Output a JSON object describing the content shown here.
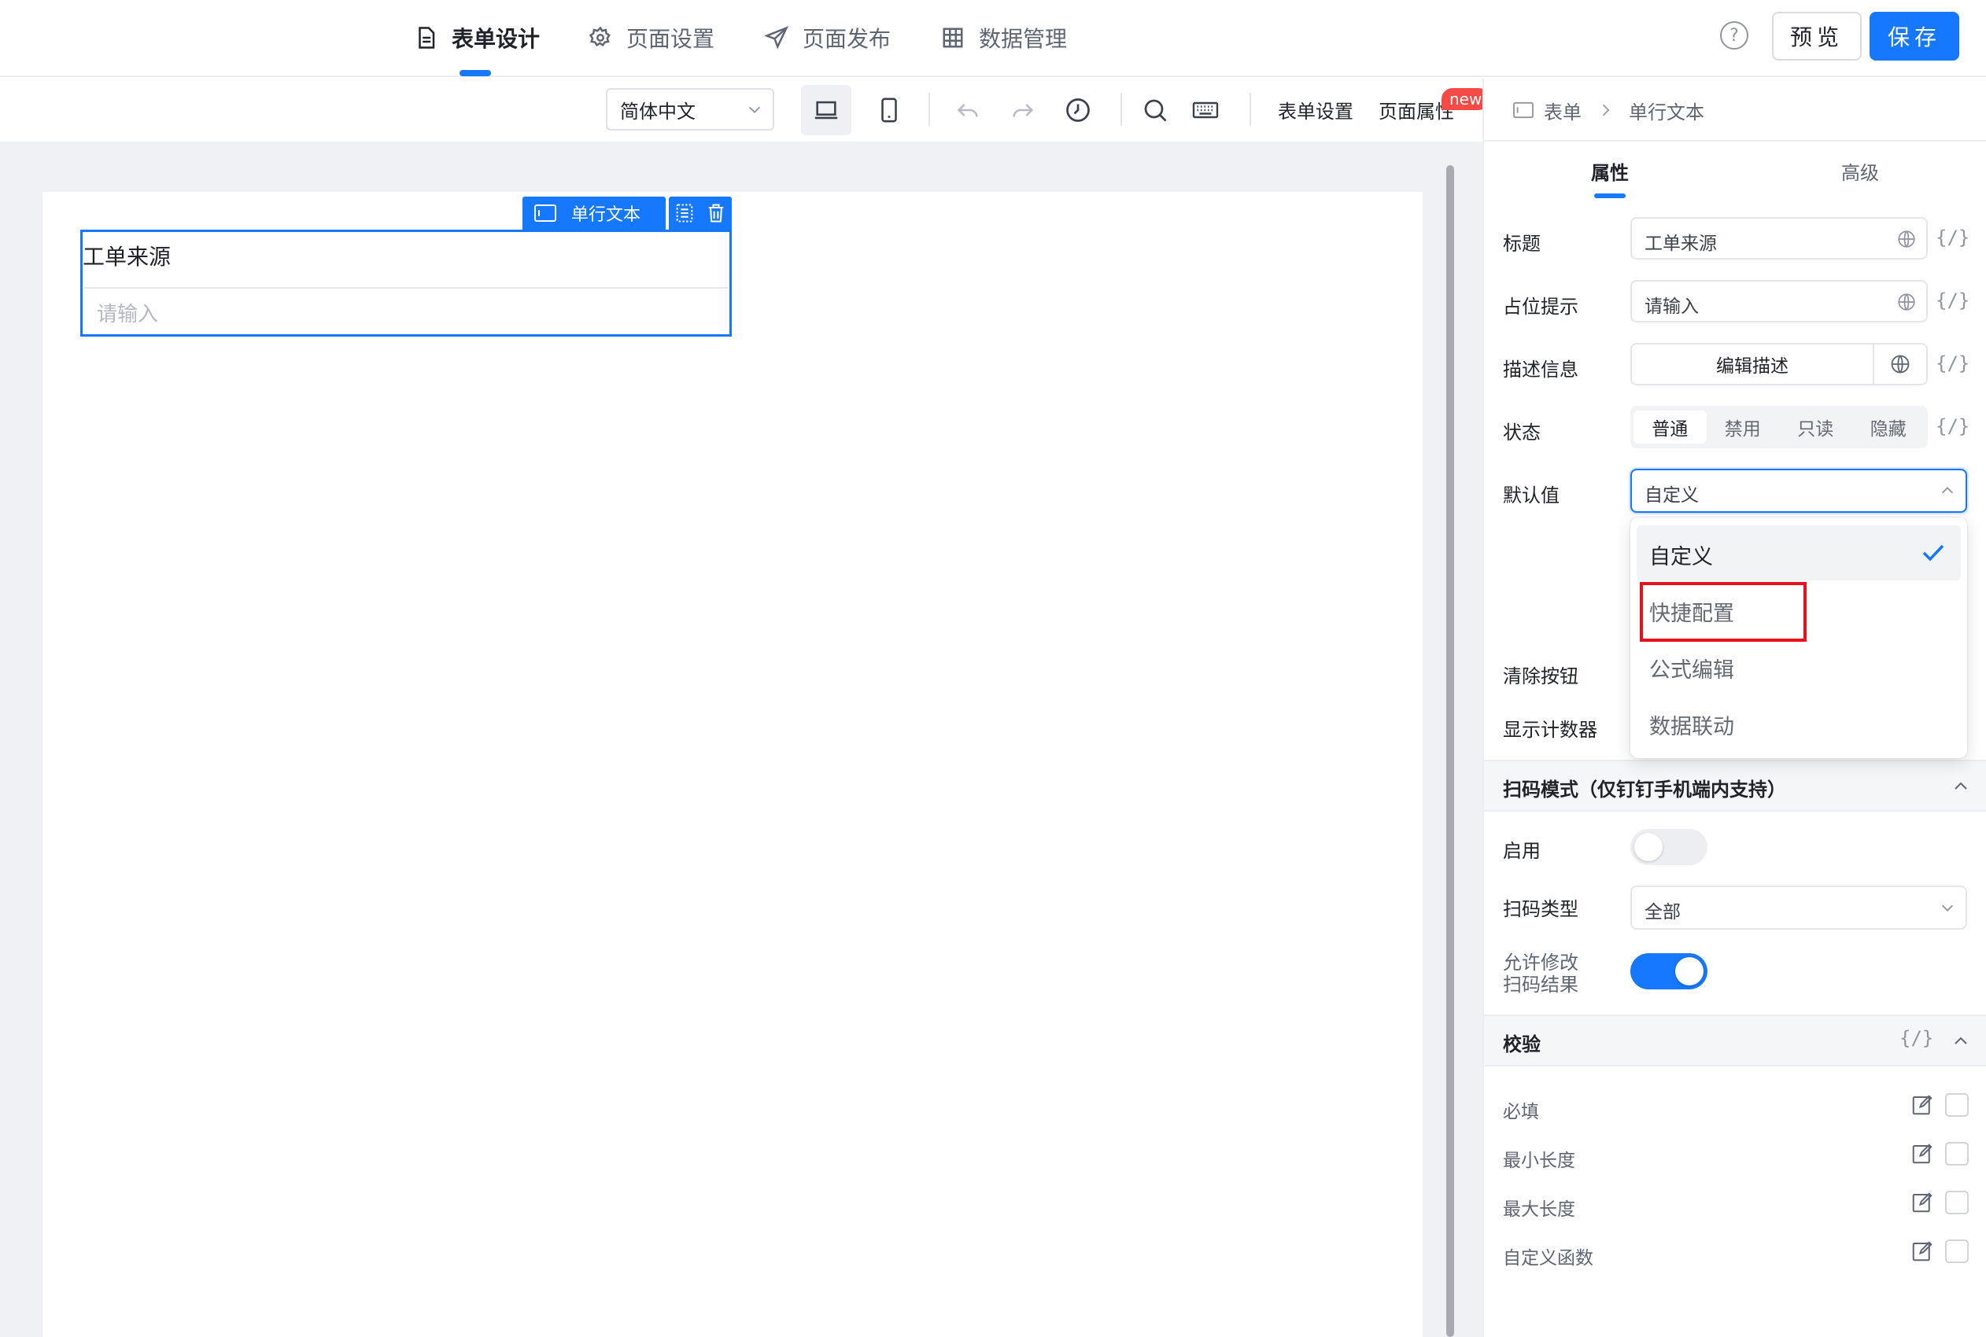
{
  "nav": {
    "tabs": [
      {
        "label": "表单设计",
        "icon": "document-icon",
        "active": true
      },
      {
        "label": "页面设置",
        "icon": "gear-icon",
        "active": false
      },
      {
        "label": "页面发布",
        "icon": "send-icon",
        "active": false
      },
      {
        "label": "数据管理",
        "icon": "table-icon",
        "active": false
      }
    ],
    "help_glyph": "?",
    "preview_label": "预览",
    "save_label": "保存"
  },
  "toolbar": {
    "language": "简体中文",
    "form_settings_label": "表单设置",
    "page_props_label": "页面属性",
    "new_badge": "new"
  },
  "canvas": {
    "field_type_chip": "单行文本",
    "field_title": "工单来源",
    "field_placeholder": "请输入"
  },
  "panel": {
    "breadcrumb": [
      "表单",
      "单行文本"
    ],
    "tabs": [
      "属性",
      "高级"
    ],
    "active_tab": "属性",
    "expr_glyph": "{/}",
    "props": {
      "title_label": "标题",
      "title_value": "工单来源",
      "placeholder_label": "占位提示",
      "placeholder_value": "请输入",
      "desc_label": "描述信息",
      "desc_button": "编辑描述",
      "status_label": "状态",
      "status_options": [
        "普通",
        "禁用",
        "只读",
        "隐藏"
      ],
      "status_selected": "普通",
      "default_label": "默认值",
      "default_value": "自定义",
      "default_options": [
        "自定义",
        "快捷配置",
        "公式编辑",
        "数据联动"
      ],
      "clear_label": "清除按钮",
      "counter_label": "显示计数器"
    },
    "scan": {
      "section_title": "扫码模式（仅钉钉手机端内支持）",
      "enable_label": "启用",
      "enable_on": false,
      "type_label": "扫码类型",
      "type_value": "全部",
      "allow_edit_label_1": "允许修改",
      "allow_edit_label_2": "扫码结果",
      "allow_edit_on": true
    },
    "validation": {
      "section_title": "校验",
      "rules": [
        "必填",
        "最小长度",
        "最大长度",
        "自定义函数"
      ]
    }
  },
  "colors": {
    "accent": "#1677ff",
    "highlight": "#e8101a",
    "badge": "#f54a45"
  }
}
